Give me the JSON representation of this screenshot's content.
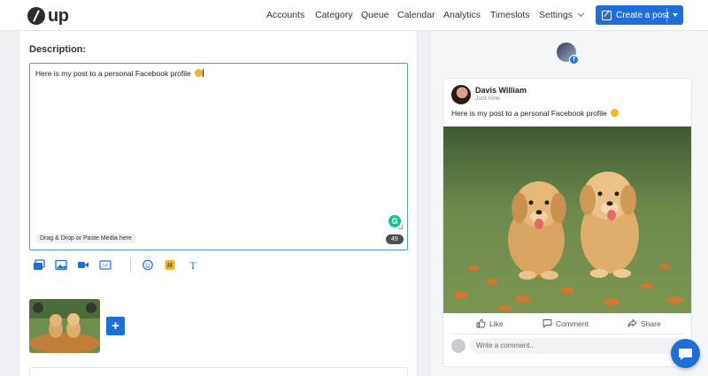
{
  "app": {
    "logo_text": "up"
  },
  "nav": {
    "items": [
      {
        "label": "Accounts"
      },
      {
        "label": "Category"
      },
      {
        "label": "Queue"
      },
      {
        "label": "Calendar"
      },
      {
        "label": "Analytics"
      },
      {
        "label": "Timeslots"
      },
      {
        "label": "Settings"
      }
    ],
    "create_label": "Create a post"
  },
  "composer": {
    "description_label": "Description:",
    "text": "Here is my post to a personal Facebook profile",
    "drag_drop_label": "Drag & Drop or Paste Media here",
    "char_count": "49",
    "grammarly_letter": "G",
    "add_label": "+",
    "toolbar_icons": [
      "gallery-icon",
      "image-icon",
      "video-icon",
      "gif-icon",
      "emoji-icon",
      "hashtag-icon",
      "text-format-icon"
    ],
    "toolbar_gif": "GIF",
    "toolbar_text_glyph": "T"
  },
  "preview": {
    "badge_letter": "f",
    "author": "Davis William",
    "time": "Just now",
    "text": "Here is my post to a personal Facebook profile",
    "like_label": "Like",
    "comment_label": "Comment",
    "share_label": "Share",
    "comment_placeholder": "Write a comment..."
  },
  "colors": {
    "accent": "#1f6dd6",
    "editor_border": "#4a9fd8",
    "grammarly": "#15c39a",
    "facebook": "#1877f2"
  }
}
